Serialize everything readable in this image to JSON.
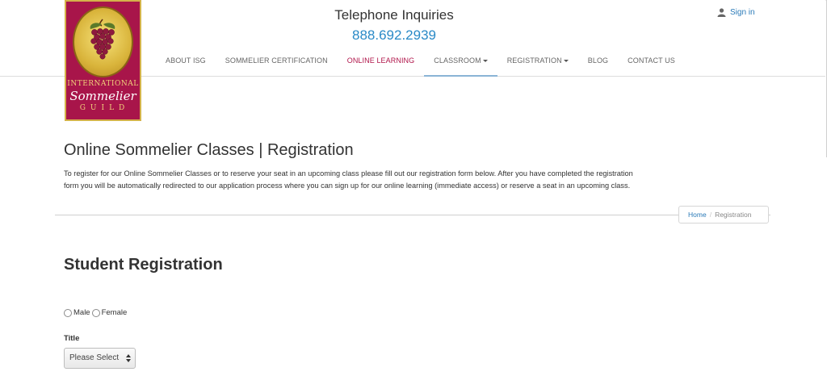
{
  "header": {
    "logo": {
      "line1": "INTERNATIONAL",
      "line2": "Sommelier",
      "line3": "GUILD"
    },
    "phone_label": "Telephone Inquiries",
    "phone_number": "888.692.2939",
    "signin_label": "Sign in"
  },
  "nav": {
    "items": [
      {
        "label": "ABOUT ISG"
      },
      {
        "label": "SOMMELIER CERTIFICATION"
      },
      {
        "label": "ONLINE LEARNING"
      },
      {
        "label": "CLASSROOM"
      },
      {
        "label": "REGISTRATION"
      },
      {
        "label": "BLOG"
      },
      {
        "label": "CONTACT US"
      }
    ]
  },
  "main": {
    "page_title": "Online Sommelier Classes | Registration",
    "intro": "To register for our Online Sommelier Classes or to reserve your seat in an upcoming class please fill out our registration form below. After you have completed the registration form you will be automatically redirected to our application process where you can sign up for our online learning (immediate access) or reserve a seat in an upcoming class.",
    "breadcrumb": {
      "home": "Home",
      "separator": "/",
      "current": "Registration"
    },
    "section_title": "Student Registration",
    "form": {
      "gender_options": [
        "Male",
        "Female"
      ],
      "title_label": "Title",
      "title_select_value": "Please Select"
    }
  },
  "colors": {
    "brand": "#a8154a",
    "link": "#2a8ac7",
    "logo_gold": "#d4b24a"
  }
}
